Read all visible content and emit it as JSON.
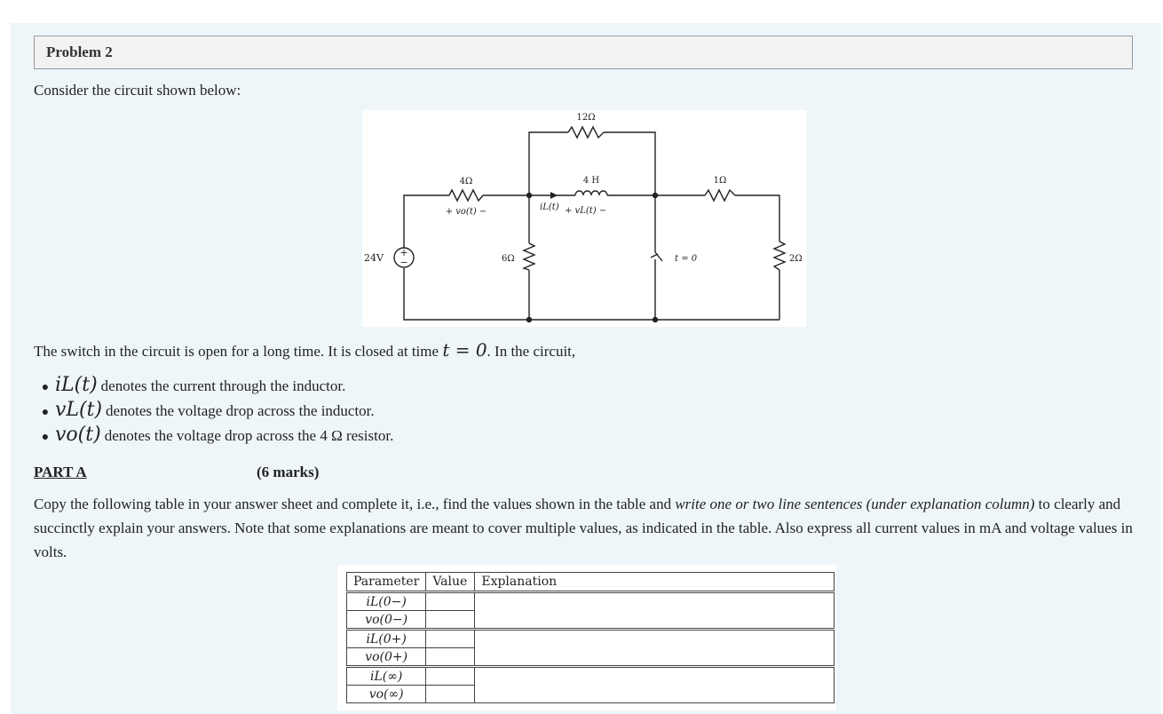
{
  "header": {
    "title": "Problem 2"
  },
  "intro": "Consider the circuit shown below:",
  "circuit": {
    "source_label": "24V",
    "r_series": "4Ω",
    "vo_label": "+ vo(t) −",
    "r_top": "12Ω",
    "inductor": "4 H",
    "il_label": "iL(t)",
    "vl_label": "+ vL(t) −",
    "r_shunt": "6Ω",
    "r_right": "1Ω",
    "r_load": "2Ω",
    "switch_label": "t = 0"
  },
  "switch_text": {
    "before": "The switch in the circuit is open for a long time. It is closed at time ",
    "math": "t = 0",
    "after": ". In the circuit,"
  },
  "definitions": [
    {
      "symbol": "iL(t)",
      "text": "denotes the current through the inductor."
    },
    {
      "symbol": "vL(t)",
      "text": "denotes the voltage drop across the inductor."
    },
    {
      "symbol": "vo(t)",
      "text": "denotes the voltage drop across the 4 Ω resistor."
    }
  ],
  "part": {
    "label": "PART A",
    "marks": "(6 marks)"
  },
  "instructions": {
    "a": "Copy the following table in your answer sheet and complete it, i.e.,  find the values shown in the table and ",
    "em": "write one or two line sentences (under explanation column)",
    "b": " to clearly and succinctly explain your answers. Note that some explanations are meant to cover multiple values, as indicated in the table. Also express all current values in mA and voltage values in volts."
  },
  "table": {
    "headers": [
      "Parameter",
      "Value",
      "Explanation"
    ],
    "rows": [
      "iL(0−)",
      "vo(0−)",
      "iL(0+)",
      "vo(0+)",
      "iL(∞)",
      "vo(∞)"
    ]
  }
}
